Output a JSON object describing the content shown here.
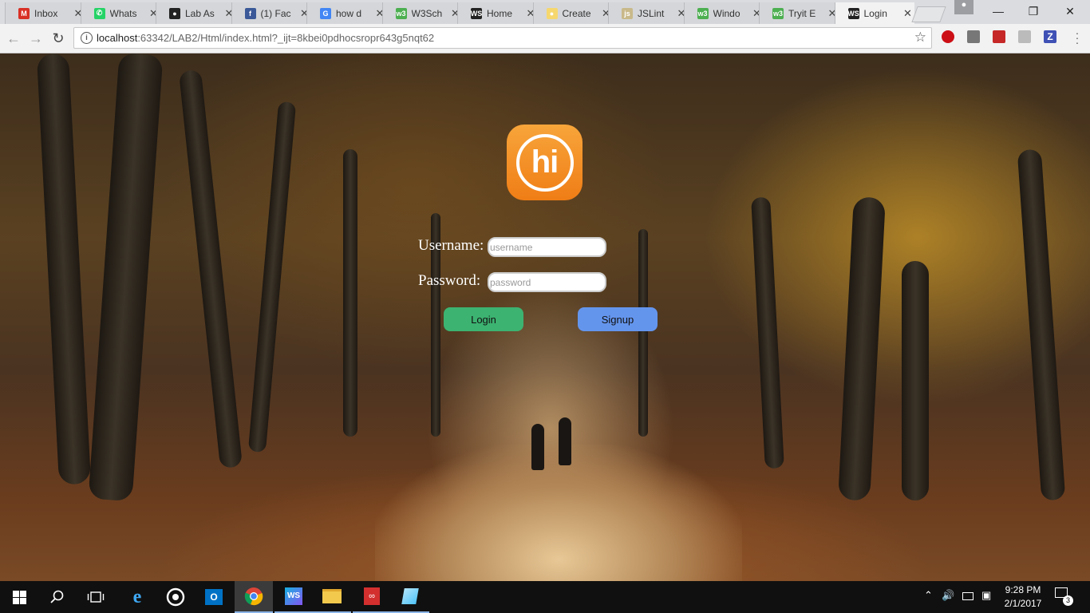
{
  "browser": {
    "tabs": [
      {
        "title": "Inbox",
        "icon": "gmail-icon",
        "color": "#d93025"
      },
      {
        "title": "Whats",
        "icon": "whatsapp-icon",
        "color": "#25d366"
      },
      {
        "title": "Lab As",
        "icon": "github-icon",
        "color": "#222222"
      },
      {
        "title": "(1) Fac",
        "icon": "facebook-icon",
        "color": "#3b5998"
      },
      {
        "title": "how d",
        "icon": "google-icon",
        "color": "#4285f4"
      },
      {
        "title": "W3Sch",
        "icon": "w3schools-icon",
        "color": "#4caf50"
      },
      {
        "title": "Home",
        "icon": "webstorm-icon",
        "color": "#222222"
      },
      {
        "title": "Create",
        "icon": "bulb-icon",
        "color": "#f5d76e"
      },
      {
        "title": "JSLint",
        "icon": "jslint-icon",
        "color": "#c9b98a"
      },
      {
        "title": "Windo",
        "icon": "w3schools-icon",
        "color": "#4caf50"
      },
      {
        "title": "Tryit E",
        "icon": "w3schools-icon",
        "color": "#4caf50"
      },
      {
        "title": "Login",
        "icon": "webstorm-icon",
        "color": "#222222"
      }
    ],
    "active_tab": "Login",
    "url_host": "localhost",
    "url_rest": ":63342/LAB2/Html/index.html?_ijt=8kbei0pdhocsropr643g5nqt62"
  },
  "login": {
    "logo_text": "hi",
    "username_label": "Username:",
    "username_placeholder": "username",
    "password_label": "Password:",
    "password_placeholder": "password",
    "login_label": "Login",
    "signup_label": "Signup",
    "login_color": "#3cb371",
    "signup_color": "#6495ed"
  },
  "taskbar": {
    "time": "9:28 PM",
    "date": "2/1/2017",
    "notification_count": "3"
  }
}
